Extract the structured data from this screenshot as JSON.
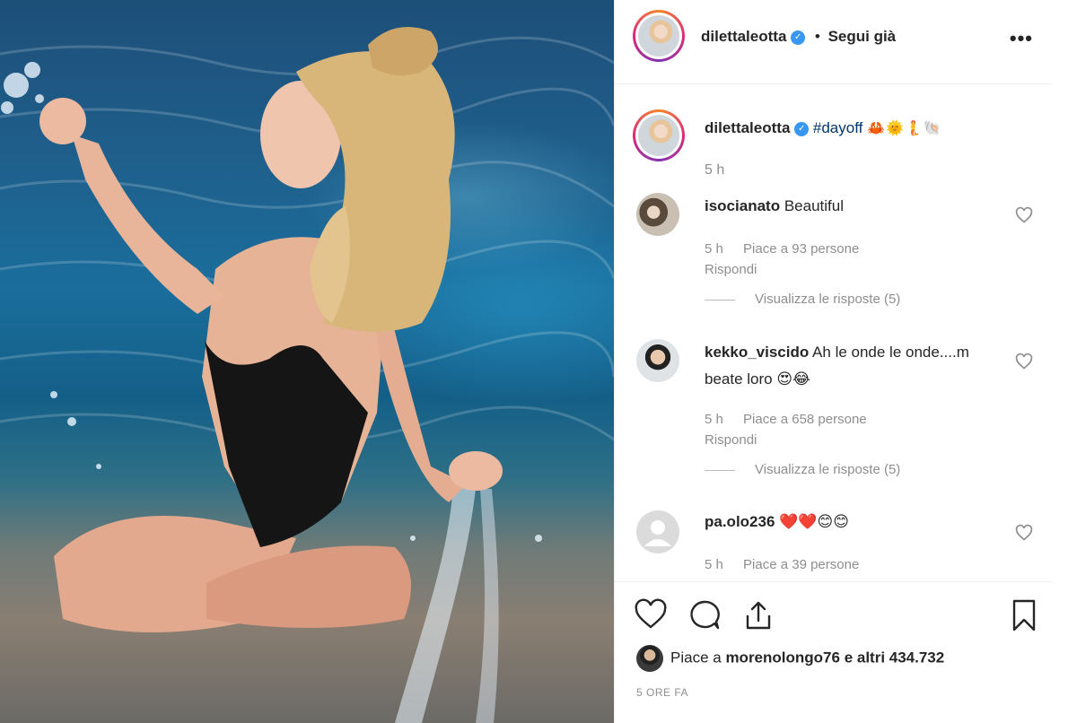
{
  "post": {
    "author": "dilettaleotta",
    "verified_mark": "✓",
    "separator": "•",
    "follow_status": "Segui già",
    "more_icon": "•••",
    "caption_hashtag": "#dayoff",
    "caption_emojis": "🦀🌞🧜🐚",
    "caption_time": "5 h"
  },
  "comments": [
    {
      "user": "isocianato",
      "text": "Beautiful",
      "time": "5 h",
      "likes": "Piace a 93 persone",
      "reply": "Rispondi",
      "view_replies": "Visualizza le risposte (5)"
    },
    {
      "user": "kekko_viscido",
      "text": "Ah le onde le onde....m beate loro 😍😂",
      "time": "5 h",
      "likes": "Piace a 658 persone",
      "reply": "Rispondi",
      "view_replies": "Visualizza le risposte (5)"
    },
    {
      "user": "pa.olo236",
      "text": "❤️❤️😊😊",
      "time": "5 h",
      "likes": "Piace a 39 persone"
    }
  ],
  "actions": {
    "likes_prefix": "Piace a",
    "liked_by": "morenolongo76",
    "likes_suffix": "e altri 434.732",
    "time_ago": "5 ORE FA"
  },
  "colors": {
    "link": "#00376b",
    "muted": "#8e8e8e",
    "verified": "#3897f0"
  }
}
